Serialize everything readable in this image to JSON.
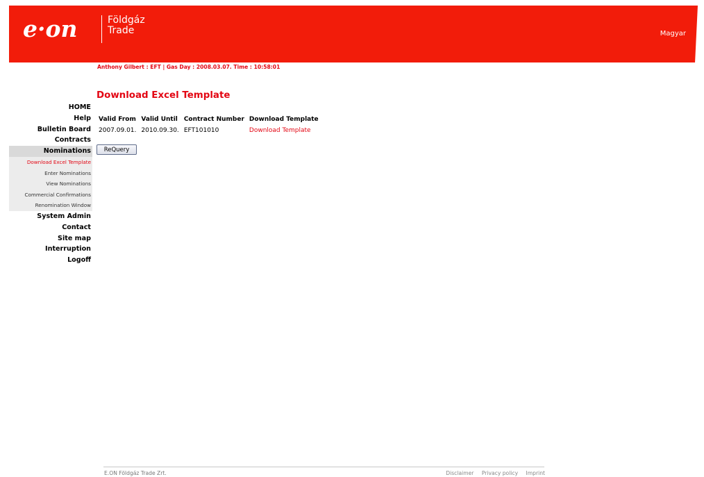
{
  "header": {
    "logo_text": "e·on",
    "brand_line1": "Földgáz",
    "brand_line2": "Trade",
    "language_link": "Magyar",
    "colors": {
      "brand_red": "#f21c0a",
      "text_red": "#e30613"
    }
  },
  "userbar": {
    "text": "Anthony Gilbert : EFT | Gas Day : 2008.03.07. Time : 10:58:01"
  },
  "sidebar": {
    "items": [
      {
        "label": "HOME"
      },
      {
        "label": "Help"
      },
      {
        "label": "Bulletin Board"
      },
      {
        "label": "Contracts"
      },
      {
        "label": "Nominations",
        "active": true
      }
    ],
    "subitems": [
      {
        "label": "Download Excel Template",
        "current": true
      },
      {
        "label": "Enter Nominations"
      },
      {
        "label": "View Nominations"
      },
      {
        "label": "Commercial Confirmations"
      },
      {
        "label": "Renomination Window"
      }
    ],
    "items_after": [
      {
        "label": "System Admin"
      },
      {
        "label": "Contact"
      },
      {
        "label": "Site map"
      },
      {
        "label": "Interruption"
      },
      {
        "label": "Logoff"
      }
    ]
  },
  "main": {
    "title": "Download Excel Template",
    "table": {
      "headers": [
        "Valid From",
        "Valid Until",
        "Contract Number",
        "Download Template"
      ],
      "rows": [
        {
          "valid_from": "2007.09.01.",
          "valid_until": "2010.09.30.",
          "contract_number": "EFT101010",
          "download": "Download Template"
        }
      ]
    },
    "requery_button": "ReQuery"
  },
  "footer": {
    "company": "E.ON Földgáz Trade Zrt.",
    "links": [
      "Disclaimer",
      "Privacy policy",
      "Imprint"
    ]
  }
}
